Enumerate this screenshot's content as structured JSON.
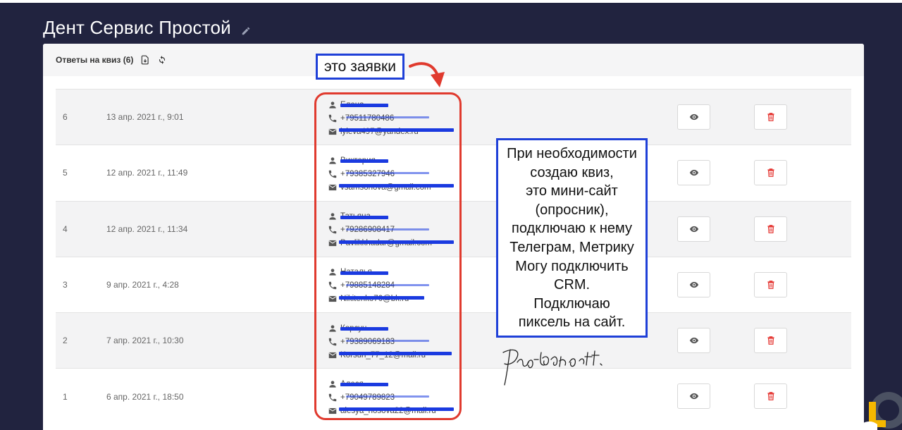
{
  "page": {
    "title": "Дент Сервис Простой"
  },
  "card": {
    "header_title": "Ответы на квиз (6)"
  },
  "rows": [
    {
      "num": "6",
      "date": "13 апр. 2021 г., 9:01",
      "name": "Елена",
      "phone": "+79511780486",
      "email": "lyleva497@yandex.ru"
    },
    {
      "num": "5",
      "date": "12 апр. 2021 г., 11:49",
      "name": "Виктория",
      "phone": "+79385327946",
      "email": "vsamsonova@gmail.com"
    },
    {
      "num": "4",
      "date": "12 апр. 2021 г., 11:34",
      "name": "Татьяна",
      "phone": "+79286908417",
      "email": "Pavlikkhadar@gmail.com"
    },
    {
      "num": "3",
      "date": "9 апр. 2021 г., 4:28",
      "name": "Наталья",
      "phone": "+79885148284",
      "email": "Nikitenko70@bk.ru"
    },
    {
      "num": "2",
      "date": "7 апр. 2021 г., 10:30",
      "name": "Корсун",
      "phone": "+79389069183",
      "email": "Korsun_77_12@mail.ru"
    },
    {
      "num": "1",
      "date": "6 апр. 2021 г., 18:50",
      "name": "Алеся",
      "phone": "+79049789823",
      "email": "alesya_nosova22@mail.ru"
    }
  ],
  "annotations": {
    "label": "это заявки",
    "note_lines": [
      "При необходимости",
      "создаю квиз,",
      "это мини-сайт",
      "(опросник),",
      "подключаю к нему",
      "Телеграм, Метрику",
      "Могу подключить",
      "CRM.",
      "Подключаю",
      "пиксель на сайт."
    ]
  },
  "colors": {
    "background": "#21233f",
    "card": "#ffffff",
    "annotation_blue": "#1f40d8",
    "annotation_red": "#e03a2e",
    "delete_red": "#e53935",
    "redaction": "#1a3ae0"
  },
  "icons": {
    "title_edit": "pencil-icon",
    "header_export": "file-download-icon",
    "header_refresh": "refresh-icon",
    "contact_name": "person-icon",
    "contact_phone": "phone-icon",
    "contact_email": "mail-icon",
    "row_view": "eye-icon",
    "row_delete": "trash-icon"
  }
}
